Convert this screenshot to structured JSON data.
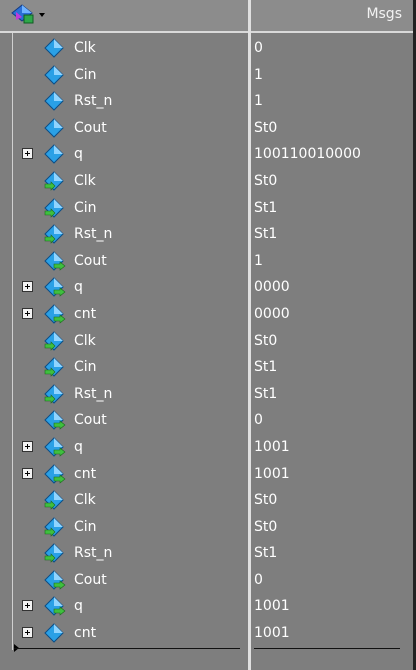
{
  "header": {
    "msgs_title": "Msgs",
    "icon": "wave-format-dropdown-icon"
  },
  "rows": [
    {
      "label": "Clk",
      "value": "0",
      "expander": false,
      "icon": "input-diamond-icon"
    },
    {
      "label": "Cin",
      "value": "1",
      "expander": false,
      "icon": "input-diamond-icon"
    },
    {
      "label": "Rst_n",
      "value": "1",
      "expander": false,
      "icon": "input-diamond-icon"
    },
    {
      "label": "Cout",
      "value": "St0",
      "expander": false,
      "icon": "input-diamond-icon"
    },
    {
      "label": "q",
      "value": "100110010000",
      "expander": true,
      "icon": "input-diamond-icon"
    },
    {
      "label": "Clk",
      "value": "St0",
      "expander": false,
      "icon": "in-port-diamond-icon"
    },
    {
      "label": "Cin",
      "value": "St1",
      "expander": false,
      "icon": "in-port-diamond-icon"
    },
    {
      "label": "Rst_n",
      "value": "St1",
      "expander": false,
      "icon": "in-port-diamond-icon"
    },
    {
      "label": "Cout",
      "value": "1",
      "expander": false,
      "icon": "out-port-diamond-icon"
    },
    {
      "label": "q",
      "value": "0000",
      "expander": true,
      "icon": "out-port-diamond-icon"
    },
    {
      "label": "cnt",
      "value": "0000",
      "expander": true,
      "icon": "out-port-diamond-icon"
    },
    {
      "label": "Clk",
      "value": "St0",
      "expander": false,
      "icon": "in-port-diamond-icon"
    },
    {
      "label": "Cin",
      "value": "St1",
      "expander": false,
      "icon": "in-port-diamond-icon"
    },
    {
      "label": "Rst_n",
      "value": "St1",
      "expander": false,
      "icon": "in-port-diamond-icon"
    },
    {
      "label": "Cout",
      "value": "0",
      "expander": false,
      "icon": "out-port-diamond-icon"
    },
    {
      "label": "q",
      "value": "1001",
      "expander": true,
      "icon": "out-port-diamond-icon"
    },
    {
      "label": "cnt",
      "value": "1001",
      "expander": true,
      "icon": "out-port-diamond-icon"
    },
    {
      "label": "Clk",
      "value": "St0",
      "expander": false,
      "icon": "in-port-diamond-icon"
    },
    {
      "label": "Cin",
      "value": "St0",
      "expander": false,
      "icon": "in-port-diamond-icon"
    },
    {
      "label": "Rst_n",
      "value": "St1",
      "expander": false,
      "icon": "in-port-diamond-icon"
    },
    {
      "label": "Cout",
      "value": "0",
      "expander": false,
      "icon": "out-port-diamond-icon"
    },
    {
      "label": "q",
      "value": "1001",
      "expander": true,
      "icon": "out-port-diamond-icon"
    },
    {
      "label": "cnt",
      "value": "1001",
      "expander": true,
      "icon": "input-diamond-icon"
    }
  ],
  "colors": {
    "background": "#7e7e7e",
    "diamond": "#2aa0e6",
    "arrow": "#3fbf3f",
    "text": "#ffffff"
  }
}
